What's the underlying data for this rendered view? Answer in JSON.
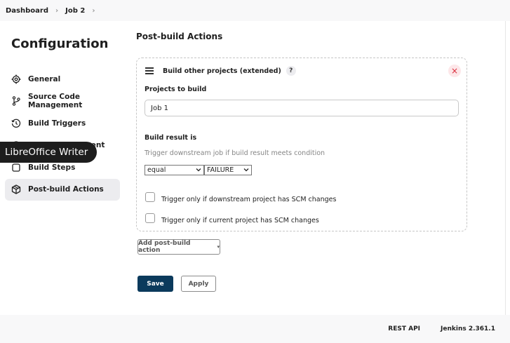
{
  "breadcrumb": {
    "items": [
      "Dashboard",
      "Job 2"
    ]
  },
  "sidebar": {
    "title": "Configuration",
    "items": [
      {
        "label": "General",
        "icon": "gear-icon"
      },
      {
        "label": "Source Code Management",
        "icon": "branch-icon"
      },
      {
        "label": "Build Triggers",
        "icon": "clock-icon"
      },
      {
        "label": "Build Environment",
        "icon": "environment-icon"
      },
      {
        "label": "Build Steps",
        "icon": "steps-icon"
      },
      {
        "label": "Post-build Actions",
        "icon": "package-icon",
        "active": true
      }
    ]
  },
  "tooltip": {
    "text": "LibreOffice Writer"
  },
  "main": {
    "section_title": "Post-build Actions",
    "card": {
      "title": "Build other projects (extended)",
      "help": "?",
      "close": "×",
      "projects_label": "Projects to build",
      "projects_value": "Job 1",
      "result_label": "Build result is",
      "result_desc": "Trigger downstream job if build result meets condition",
      "condition_select": "equal",
      "result_select": "FAILURE",
      "checkbox1": "Trigger only if downstream project has SCM changes",
      "checkbox2": "Trigger only if current project has SCM changes"
    },
    "add_action": "Add post-build action",
    "save": "Save",
    "apply": "Apply"
  },
  "footer": {
    "rest_api": "REST API",
    "version": "Jenkins 2.361.1"
  }
}
